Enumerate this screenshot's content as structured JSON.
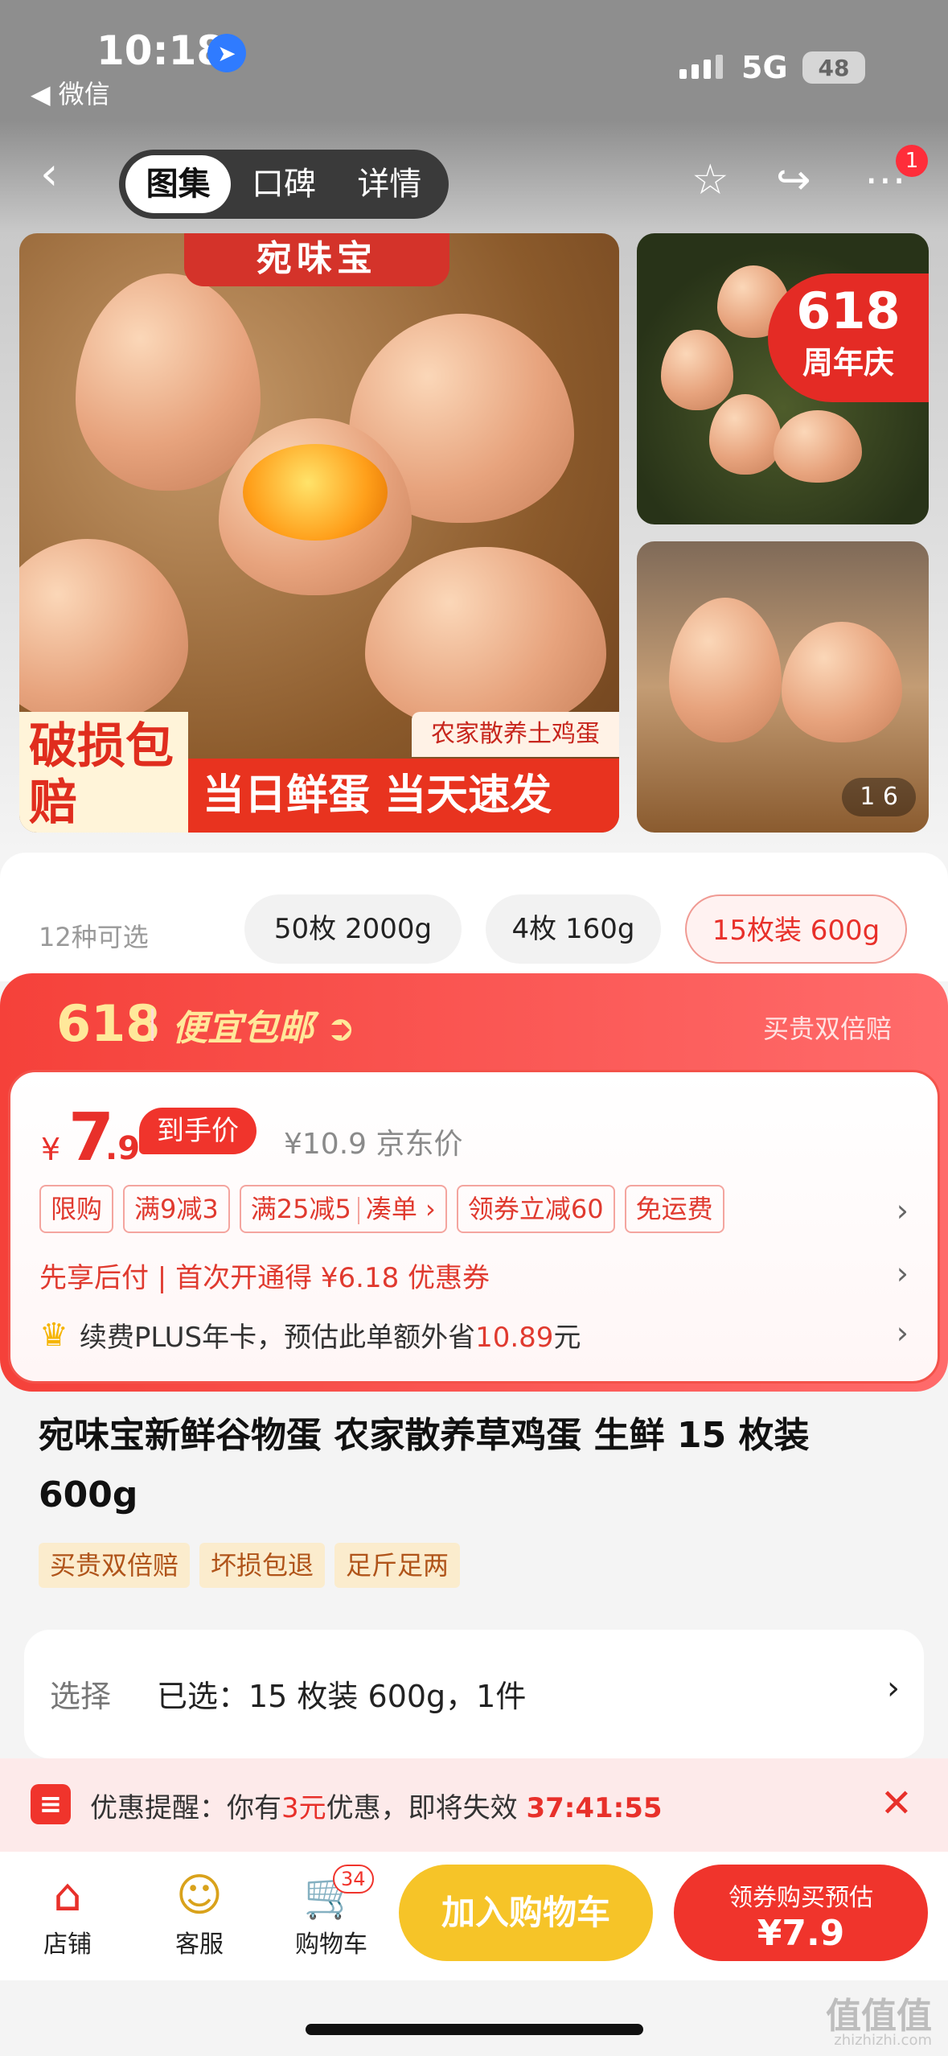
{
  "status_bar": {
    "time": "10:18",
    "back_app": "◀ 微信",
    "network": "5G",
    "battery": "48"
  },
  "nav": {
    "tabs": [
      {
        "label": "图集",
        "active": true
      },
      {
        "label": "口碑"
      },
      {
        "label": "详情"
      }
    ],
    "badge": "1",
    "icons": [
      "back-arrow-icon",
      "star-icon",
      "share-icon",
      "more-icon"
    ]
  },
  "gallery": {
    "brand_tag": "宛味宝",
    "left_ribbon": "破损包赔",
    "right_ribbon": "当日鲜蛋 当天速发",
    "caption": "农家散养土鸡蛋",
    "badge_618": {
      "number": "618",
      "text": "周年庆"
    },
    "pager": "1 6"
  },
  "options": {
    "count_label": "12种可选",
    "chips": [
      {
        "label": "50枚 2000g"
      },
      {
        "label": "4枚 160g"
      },
      {
        "label": "15枚装 600g",
        "selected": true
      }
    ]
  },
  "promo": {
    "label_618": "618",
    "free_shipping": "便宜包邮",
    "guarantee": "买贵双倍赔",
    "price": {
      "currency": "¥",
      "integer": "7",
      "decimal": ".9",
      "tag": "到手价",
      "original": "¥10.9 京东价"
    },
    "coupons": [
      "限购",
      "满9减3",
      "满25减5",
      "凑单 ›",
      "领券立减60",
      "免运费"
    ],
    "afterpay": "先享后付 | 首次开通得 ¥6.18 优惠券",
    "plus_prefix": "续费PLUS年卡，预估此单额外省",
    "plus_amount": "10.89",
    "plus_suffix": "元"
  },
  "product": {
    "title": "宛味宝新鲜谷物蛋 农家散养草鸡蛋 生鲜 15 枚装 600g",
    "badges": [
      "买贵双倍赔",
      "坏损包退",
      "足斤足两"
    ]
  },
  "select": {
    "label": "选择",
    "value": "已选：15 枚装 600g，1件",
    "arrow": "›"
  },
  "reminder": {
    "prefix": "优惠提醒：你有",
    "amount": "3元",
    "middle": "优惠，即将失效",
    "timer": "37:41:55"
  },
  "bottom_bar": {
    "store": "店铺",
    "service": "客服",
    "cart": "购物车",
    "cart_count": "34",
    "add_cart": "加入购物车",
    "buy_line1": "领券购买预估",
    "buy_line2": "¥7.9"
  },
  "watermark": {
    "main": "值值值",
    "sub": "zhizhizhi.com"
  },
  "colors": {
    "accent_red": "#f0342c",
    "accent_yellow": "#f6c428",
    "price_red": "#e8302a"
  }
}
